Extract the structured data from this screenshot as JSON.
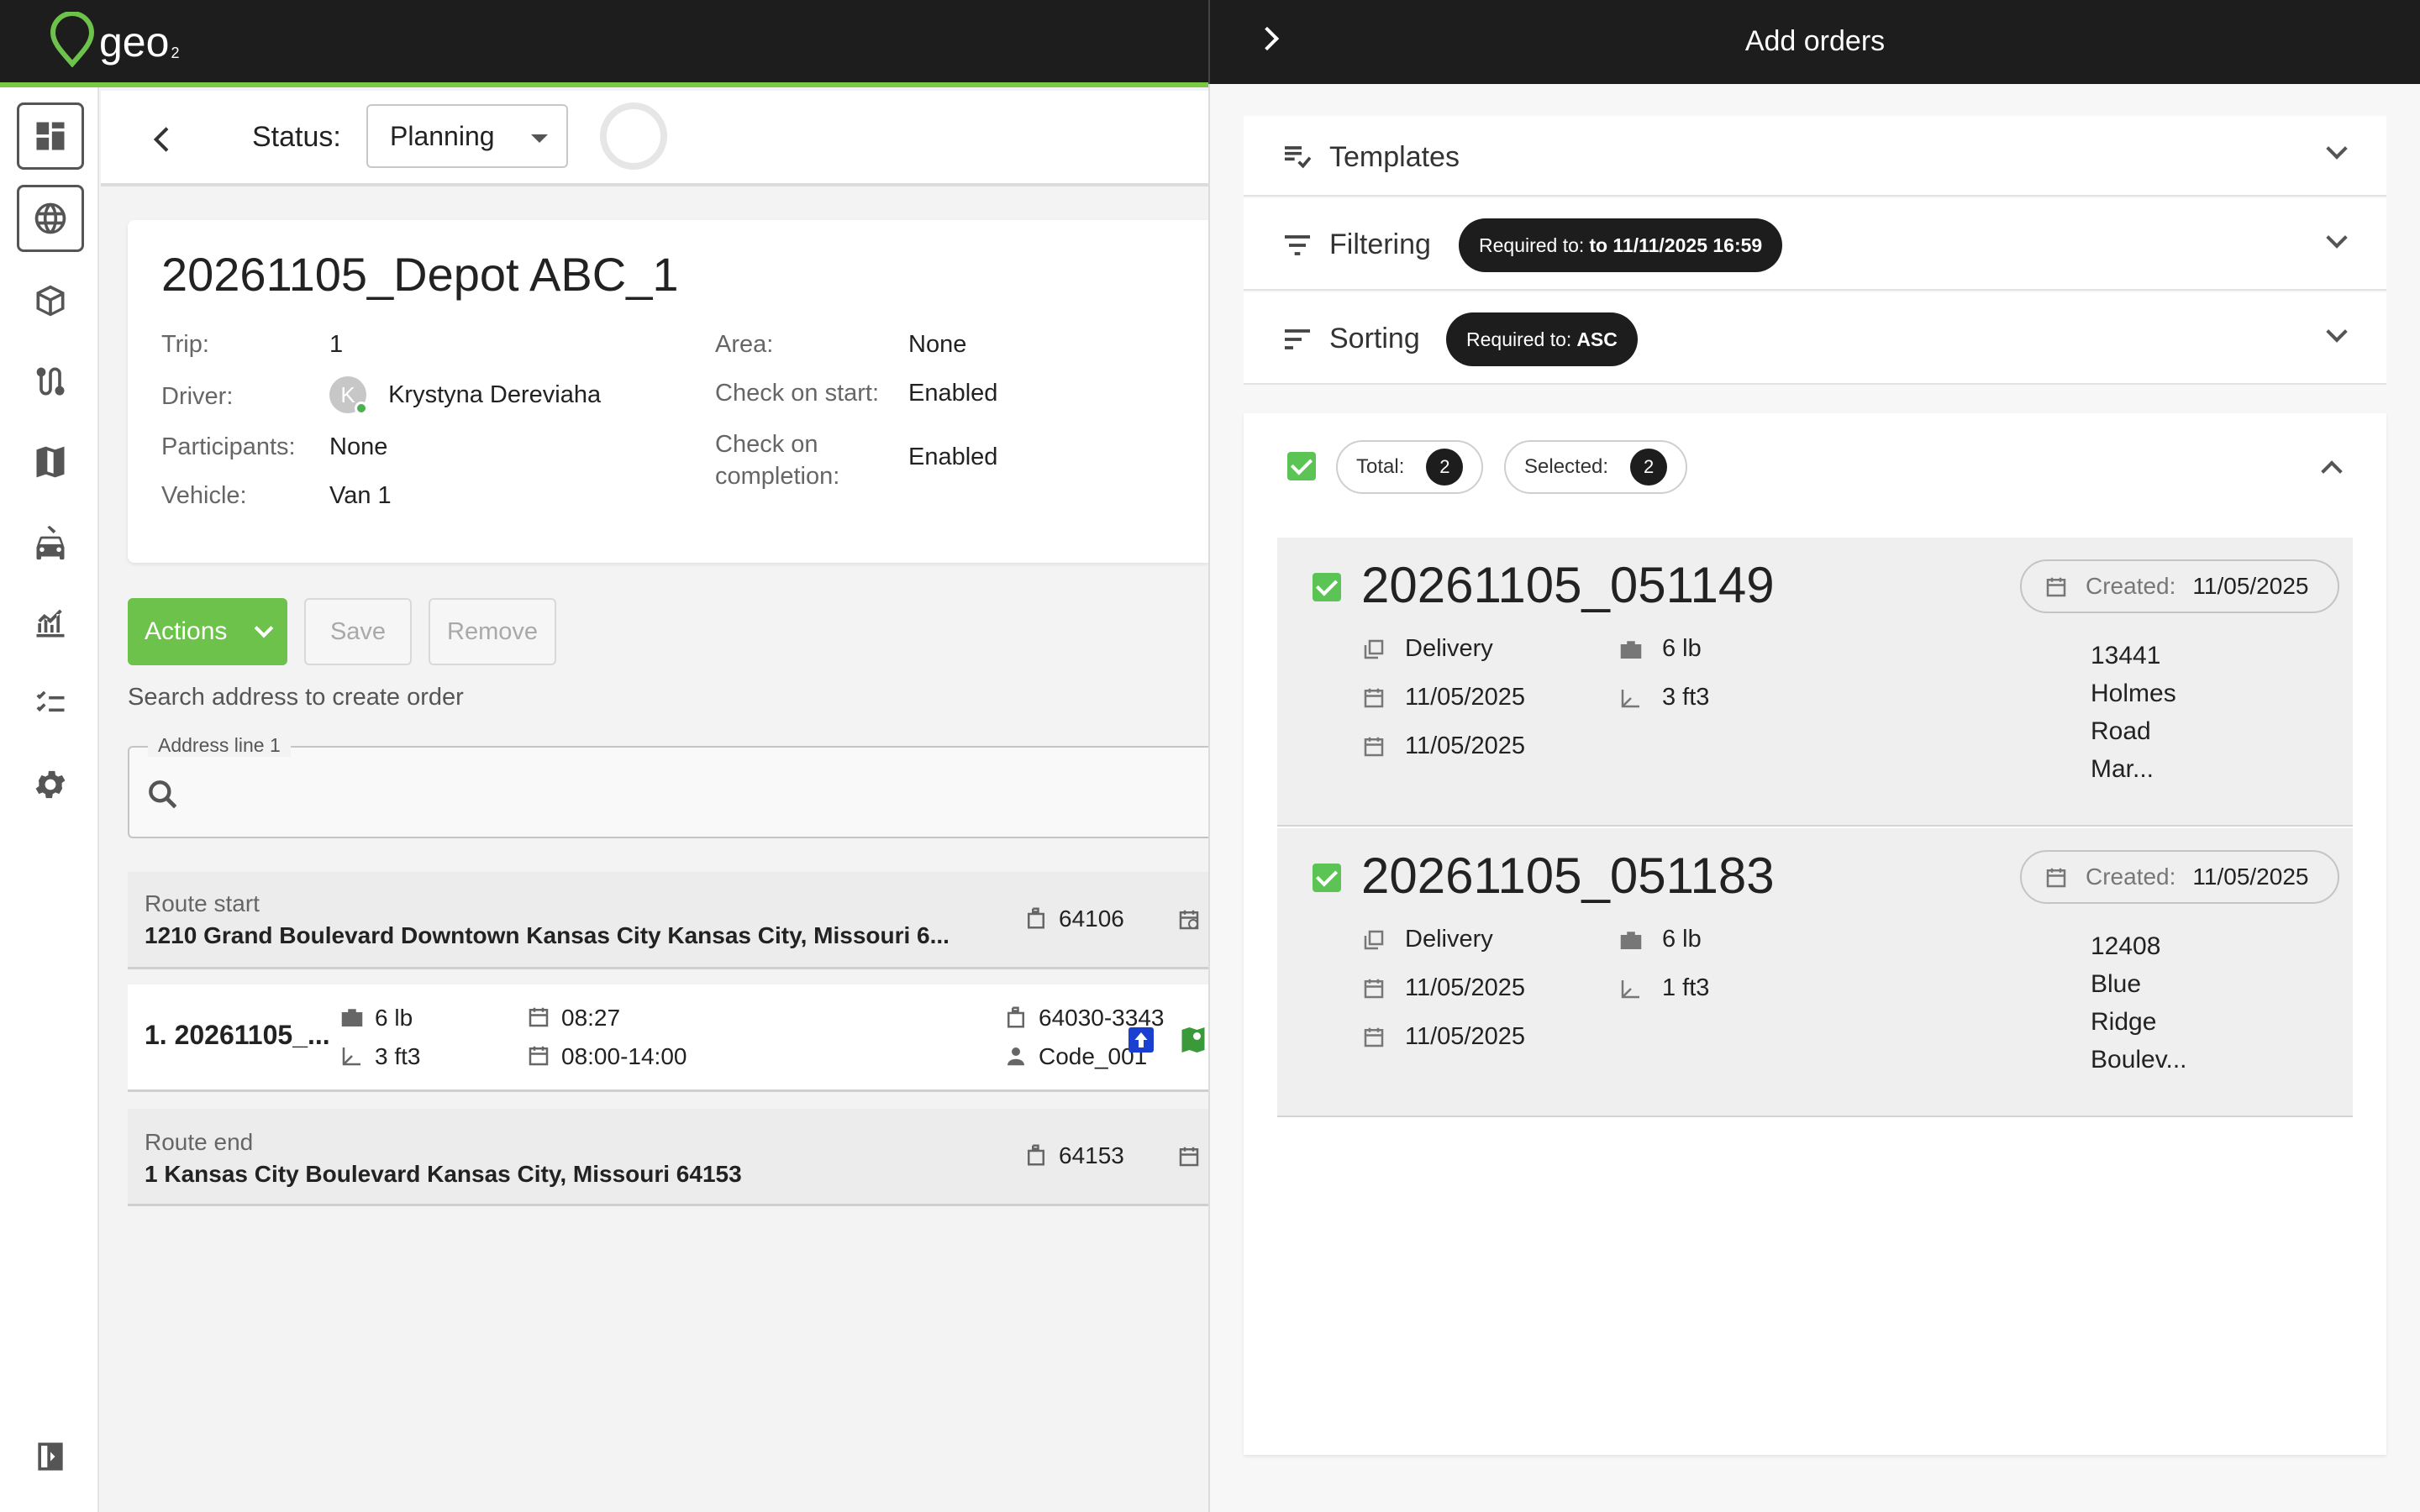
{
  "app": {
    "logo_text": "geo",
    "logo_sub": "2"
  },
  "rail": {
    "items": [
      {
        "name": "dashboard-icon"
      },
      {
        "name": "globe-icon"
      },
      {
        "name": "package-icon"
      },
      {
        "name": "route-icon"
      },
      {
        "name": "map-icon"
      },
      {
        "name": "vehicle-icon"
      },
      {
        "name": "analytics-icon"
      },
      {
        "name": "checklist-icon"
      },
      {
        "name": "settings-icon"
      }
    ],
    "collapse_icon": "sidebar-collapse-icon"
  },
  "status_bar": {
    "label": "Status:",
    "value": "Planning"
  },
  "trip": {
    "title": "20261105_Depot ABC_1",
    "trip_label": "Trip:",
    "trip_value": "1",
    "driver_label": "Driver:",
    "driver_initial": "K",
    "driver_value": "Krystyna Dereviaha",
    "participants_label": "Participants:",
    "participants_value": "None",
    "vehicle_label": "Vehicle:",
    "vehicle_value": "Van 1",
    "area_label": "Area:",
    "area_value": "None",
    "check_start_label": "Check on start:",
    "check_start_value": "Enabled",
    "check_completion_label_1": "Check on",
    "check_completion_label_2": "completion:",
    "check_completion_value": "Enabled"
  },
  "actions": {
    "actions_label": "Actions",
    "save_label": "Save",
    "remove_label": "Remove"
  },
  "search": {
    "caption": "Search address to create order",
    "legend": "Address line 1"
  },
  "route_start": {
    "label": "Route start",
    "address": "1210 Grand Boulevard Downtown Kansas City Kansas City, Missouri 6...",
    "zip": "64106"
  },
  "stop": {
    "name": "1. 20261105_...",
    "weight": "6 lb",
    "volume": "3 ft3",
    "time": "08:27",
    "window": "08:00-14:00",
    "zip": "64030-3343",
    "code": "Code_001"
  },
  "route_end": {
    "label": "Route end",
    "address": "1 Kansas City Boulevard Kansas City, Missouri 64153",
    "zip": "64153"
  },
  "panel": {
    "title": "Add orders",
    "templates_label": "Templates",
    "filtering_label": "Filtering",
    "filtering_pill_label": "Required to:",
    "filtering_pill_value": "to 11/11/2025 16:59",
    "sorting_label": "Sorting",
    "sorting_pill_label": "Required to:",
    "sorting_pill_value": "ASC",
    "total_label": "Total:",
    "total_value": "2",
    "selected_label": "Selected:",
    "selected_value": "2"
  },
  "orders": [
    {
      "number": "20261105_051149",
      "created_label": "Created:",
      "created_value": "11/05/2025",
      "type": "Delivery",
      "date1": "11/05/2025",
      "date2": "11/05/2025",
      "weight": "6 lb",
      "volume": "3 ft3",
      "addr1": "13441",
      "addr2": "Holmes",
      "addr3": "Road",
      "addr4": "Mar..."
    },
    {
      "number": "20261105_051183",
      "created_label": "Created:",
      "created_value": "11/05/2025",
      "type": "Delivery",
      "date1": "11/05/2025",
      "date2": "11/05/2025",
      "weight": "6 lb",
      "volume": "1 ft3",
      "addr1": "12408",
      "addr2": "Blue",
      "addr3": "Ridge",
      "addr4": "Boulev..."
    }
  ],
  "colors": {
    "brand_green": "#6cc24a",
    "check_green": "#5cc455",
    "dark": "#1d1d1d",
    "accent_blue": "#1a3fd1",
    "map_green": "#3a9a3a"
  }
}
